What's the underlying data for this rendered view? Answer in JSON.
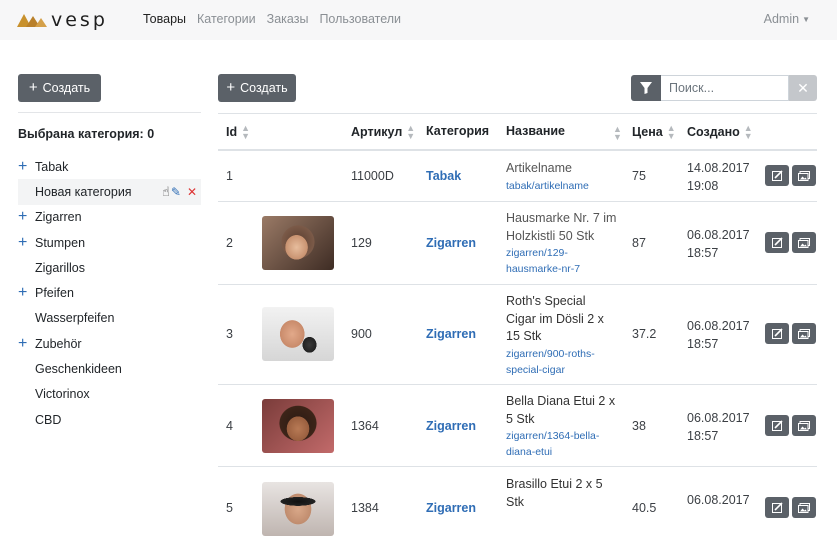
{
  "brand": "vesp",
  "nav": [
    "Товары",
    "Категории",
    "Заказы",
    "Пользователи"
  ],
  "admin": "Admin",
  "sidebar": {
    "create_label": "Создать",
    "selected_category": "Выбрана категория: 0",
    "tree": [
      {
        "label": "Tabak",
        "expandable": true
      },
      {
        "label": "Новая категория",
        "expandable": false
      },
      {
        "label": "Zigarren",
        "expandable": true
      },
      {
        "label": "Stumpen",
        "expandable": true
      },
      {
        "label": "Zigarillos",
        "expandable": false
      },
      {
        "label": "Pfeifen",
        "expandable": true
      },
      {
        "label": "Wasserpfeifen",
        "expandable": false
      },
      {
        "label": "Zubehör",
        "expandable": true
      },
      {
        "label": "Geschenkideen",
        "expandable": false
      },
      {
        "label": "Victorinox",
        "expandable": false
      },
      {
        "label": "CBD",
        "expandable": false
      }
    ]
  },
  "main": {
    "create_label": "Создать",
    "search_placeholder": "Поиск...",
    "columns": [
      "Id",
      "Артикул",
      "Категория",
      "Название",
      "Цена",
      "Создано"
    ],
    "rows": [
      {
        "id": "1",
        "article": "11000D",
        "category": "Tabak",
        "name": [
          "Artikelname"
        ],
        "slug": [
          "tabak/artikelname"
        ],
        "price": "75",
        "date": "14.08.2017",
        "time": "19:08",
        "image": "none"
      },
      {
        "id": "2",
        "article": "129",
        "category": "Zigarren",
        "name": [
          "Hausmarke Nr. 7 im",
          "Holzkistli 50 Stk"
        ],
        "slug": [
          "zigarren/129-",
          "hausmarke-nr-7"
        ],
        "price": "87",
        "date": "06.08.2017",
        "time": "18:57",
        "image": "woman-hood"
      },
      {
        "id": "3",
        "article": "900",
        "category": "Zigarren",
        "name": [
          "Roth's Special",
          "Cigar im Dösli 2 x",
          "15 Stk"
        ],
        "slug": [
          "zigarren/900-roths-",
          "special-cigar"
        ],
        "price": "37.2",
        "date": "06.08.2017",
        "time": "18:57",
        "image": "man-phone"
      },
      {
        "id": "4",
        "article": "1364",
        "category": "Zigarren",
        "name": [
          "Bella Diana Etui 2 x",
          "5 Stk"
        ],
        "slug": [
          "zigarren/1364-bella-",
          "diana-etui"
        ],
        "price": "38",
        "date": "06.08.2017",
        "time": "18:57",
        "image": "woman-smile"
      },
      {
        "id": "5",
        "article": "1384",
        "category": "Zigarren",
        "name": [
          "Brasillo Etui 2 x 5",
          "Stk"
        ],
        "slug": [],
        "price": "40.5",
        "date": "06.08.2017",
        "time": "",
        "image": "woman-sunglasses"
      }
    ]
  },
  "colors": {
    "accent": "#2f6db5",
    "button": "#5b6168",
    "danger": "#dd3333",
    "logo": "#c8912d"
  }
}
